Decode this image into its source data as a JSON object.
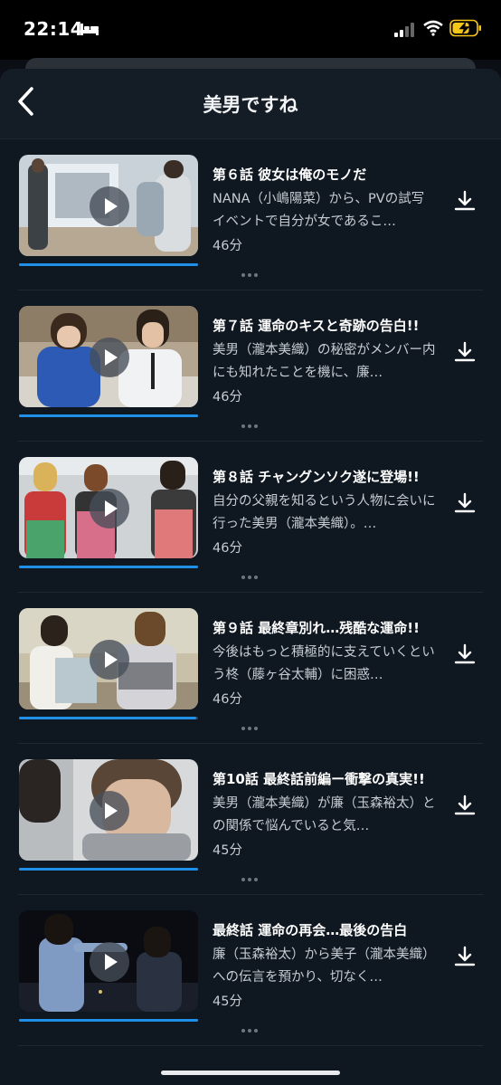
{
  "status_bar": {
    "time": "22:14",
    "icons": [
      "bed-icon",
      "signal-icon",
      "wifi-icon",
      "battery-charging-icon"
    ]
  },
  "header": {
    "title": "美男ですね",
    "back_icon": "chevron-left-icon"
  },
  "colors": {
    "background": "#0f1720",
    "progress": "#1f8fe8",
    "text_secondary": "#c6ccd3",
    "battery": "#f5c518"
  },
  "episodes": [
    {
      "title": "第６話 彼女は俺のモノだ",
      "description": "NANA（小嶋陽菜）から、PVの試写イベントで自分が女であるこ…",
      "duration": "46分",
      "progress": 1.0
    },
    {
      "title": "第７話 運命のキスと奇跡の告白!!",
      "description": "美男（瀧本美織）の秘密がメンバー内にも知れたことを機に、廉…",
      "duration": "46分",
      "progress": 1.0
    },
    {
      "title": "第８話 チャングンソク遂に登場!!",
      "description": "自分の父親を知るという人物に会いに行った美男（瀧本美織）。…",
      "duration": "46分",
      "progress": 1.0
    },
    {
      "title": "第９話 最終章別れ…残酷な運命!!",
      "description": "今後はもっと積極的に支えていくという柊（藤ヶ谷太輔）に困惑…",
      "duration": "46分",
      "progress": 0.99
    },
    {
      "title": "第10話 最終話前編ー衝撃の真実!!",
      "description": "美男（瀧本美織）が廉（玉森裕太）との関係で悩んでいると気…",
      "duration": "45分",
      "progress": 1.0
    },
    {
      "title": "最終話 運命の再会…最後の告白",
      "description": "廉（玉森裕太）から美子（瀧本美織）への伝言を預かり、切なく…",
      "duration": "45分",
      "progress": 1.0
    }
  ]
}
